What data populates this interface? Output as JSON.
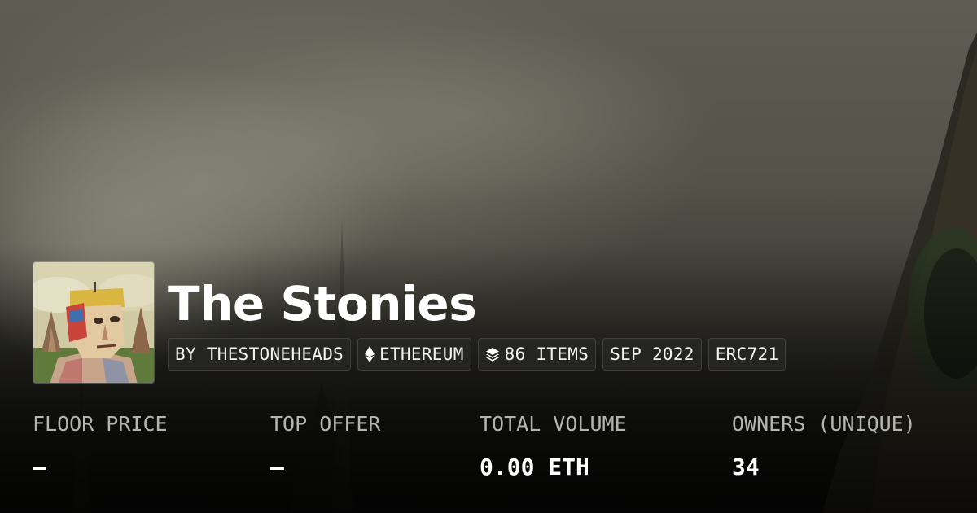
{
  "collection": {
    "name": "The Stonies",
    "tags": {
      "creator": "BY THESTONEHEADS",
      "chain": "ETHEREUM",
      "items": "86 ITEMS",
      "date": "SEP 2022",
      "standard": "ERC721"
    }
  },
  "stats": [
    {
      "label": "FLOOR PRICE",
      "value": "—"
    },
    {
      "label": "TOP OFFER",
      "value": "—"
    },
    {
      "label": "TOTAL VOLUME",
      "value": "0.00 ETH"
    },
    {
      "label": "OWNERS (UNIQUE)",
      "value": "34"
    }
  ],
  "icons": {
    "chain": "ethereum-icon",
    "items": "layers-icon"
  }
}
